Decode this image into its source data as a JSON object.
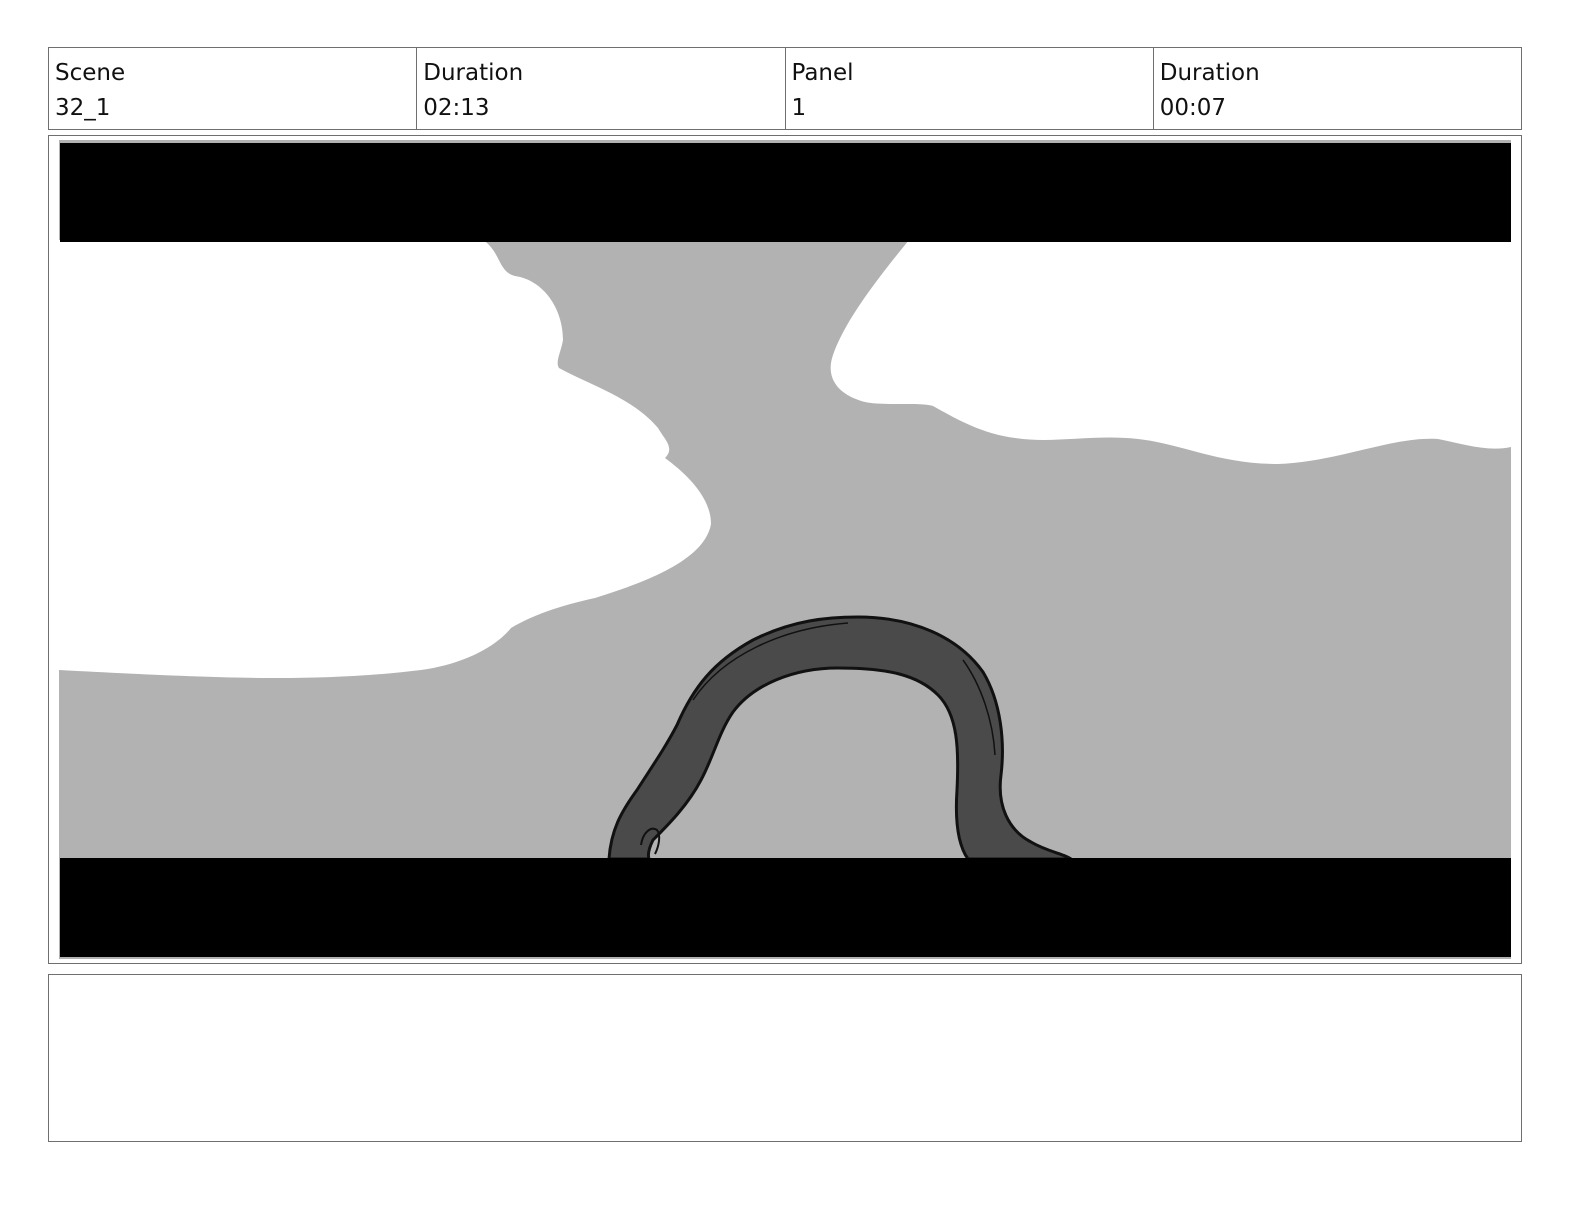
{
  "header": {
    "scene_label": "Scene",
    "scene_value": "32_1",
    "scene_duration_label": "Duration",
    "scene_duration_value": "02:13",
    "panel_label": "Panel",
    "panel_value": "1",
    "panel_duration_label": "Duration",
    "panel_duration_value": "00:07"
  },
  "panel": {
    "image_icon": "storyboard-sketch",
    "colors": {
      "letterbox": "#000000",
      "sky": "#b2b2b2",
      "cloud": "#ffffff",
      "creature": "#4a4a4a",
      "outline": "#111111"
    }
  },
  "notes": {
    "text": ""
  }
}
